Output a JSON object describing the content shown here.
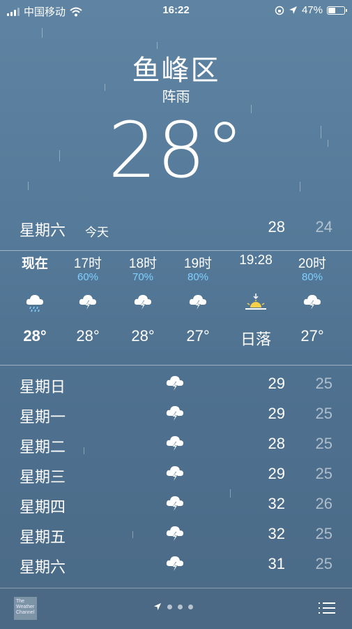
{
  "status_bar": {
    "carrier": "中国移动",
    "time": "16:22",
    "battery": "47%",
    "battery_level": 0.47
  },
  "header": {
    "city": "鱼峰区",
    "condition": "阵雨",
    "temperature": "28°"
  },
  "today": {
    "day": "星期六",
    "tag": "今天",
    "high": "28",
    "low": "24"
  },
  "hourly": [
    {
      "label": "现在",
      "precip": "",
      "icon": "rain-cloud-icon",
      "temp": "28°"
    },
    {
      "label": "17时",
      "precip": "60%",
      "icon": "thunderstorm-icon",
      "temp": "28°"
    },
    {
      "label": "18时",
      "precip": "70%",
      "icon": "thunderstorm-icon",
      "temp": "28°"
    },
    {
      "label": "19时",
      "precip": "80%",
      "icon": "thunderstorm-icon",
      "temp": "27°"
    },
    {
      "label": "19:28",
      "precip": "",
      "icon": "sunset-icon",
      "temp": "日落"
    },
    {
      "label": "20时",
      "precip": "80%",
      "icon": "thunderstorm-icon",
      "temp": "27°"
    }
  ],
  "daily": [
    {
      "day": "星期日",
      "icon": "thunderstorm-icon",
      "high": "29",
      "low": "25"
    },
    {
      "day": "星期一",
      "icon": "thunderstorm-icon",
      "high": "29",
      "low": "25"
    },
    {
      "day": "星期二",
      "icon": "thunderstorm-icon",
      "high": "28",
      "low": "25"
    },
    {
      "day": "星期三",
      "icon": "thunderstorm-icon",
      "high": "29",
      "low": "25"
    },
    {
      "day": "星期四",
      "icon": "thunderstorm-icon",
      "high": "32",
      "low": "26"
    },
    {
      "day": "星期五",
      "icon": "thunderstorm-icon",
      "high": "32",
      "low": "25"
    },
    {
      "day": "星期六",
      "icon": "thunderstorm-icon",
      "high": "31",
      "low": "25"
    }
  ],
  "footer": {
    "logo_text": "The Weather Channel"
  }
}
